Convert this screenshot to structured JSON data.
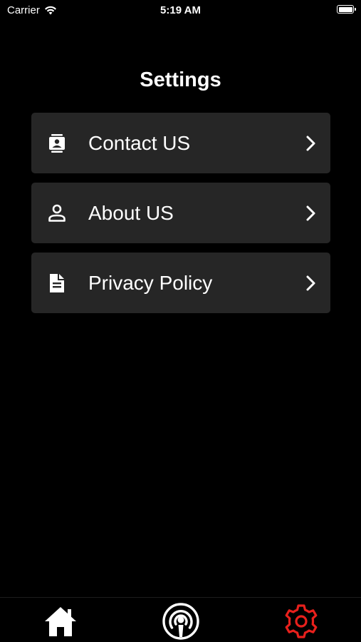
{
  "status_bar": {
    "carrier": "Carrier",
    "time": "5:19 AM",
    "icons": [
      "wifi-icon",
      "battery-icon"
    ]
  },
  "page": {
    "title": "Settings"
  },
  "settings": {
    "items": [
      {
        "label": "Contact US",
        "icon": "contact-card-icon"
      },
      {
        "label": "About US",
        "icon": "person-icon"
      },
      {
        "label": "Privacy Policy",
        "icon": "document-icon"
      }
    ]
  },
  "tab_bar": {
    "tabs": [
      {
        "icon": "home-icon",
        "active": false
      },
      {
        "icon": "podcast-icon",
        "active": false
      },
      {
        "icon": "gear-icon",
        "active": true
      }
    ],
    "active_color": "#e8201c",
    "inactive_color": "#ffffff"
  },
  "colors": {
    "background": "#000000",
    "row_background": "#262626",
    "text": "#ffffff"
  }
}
